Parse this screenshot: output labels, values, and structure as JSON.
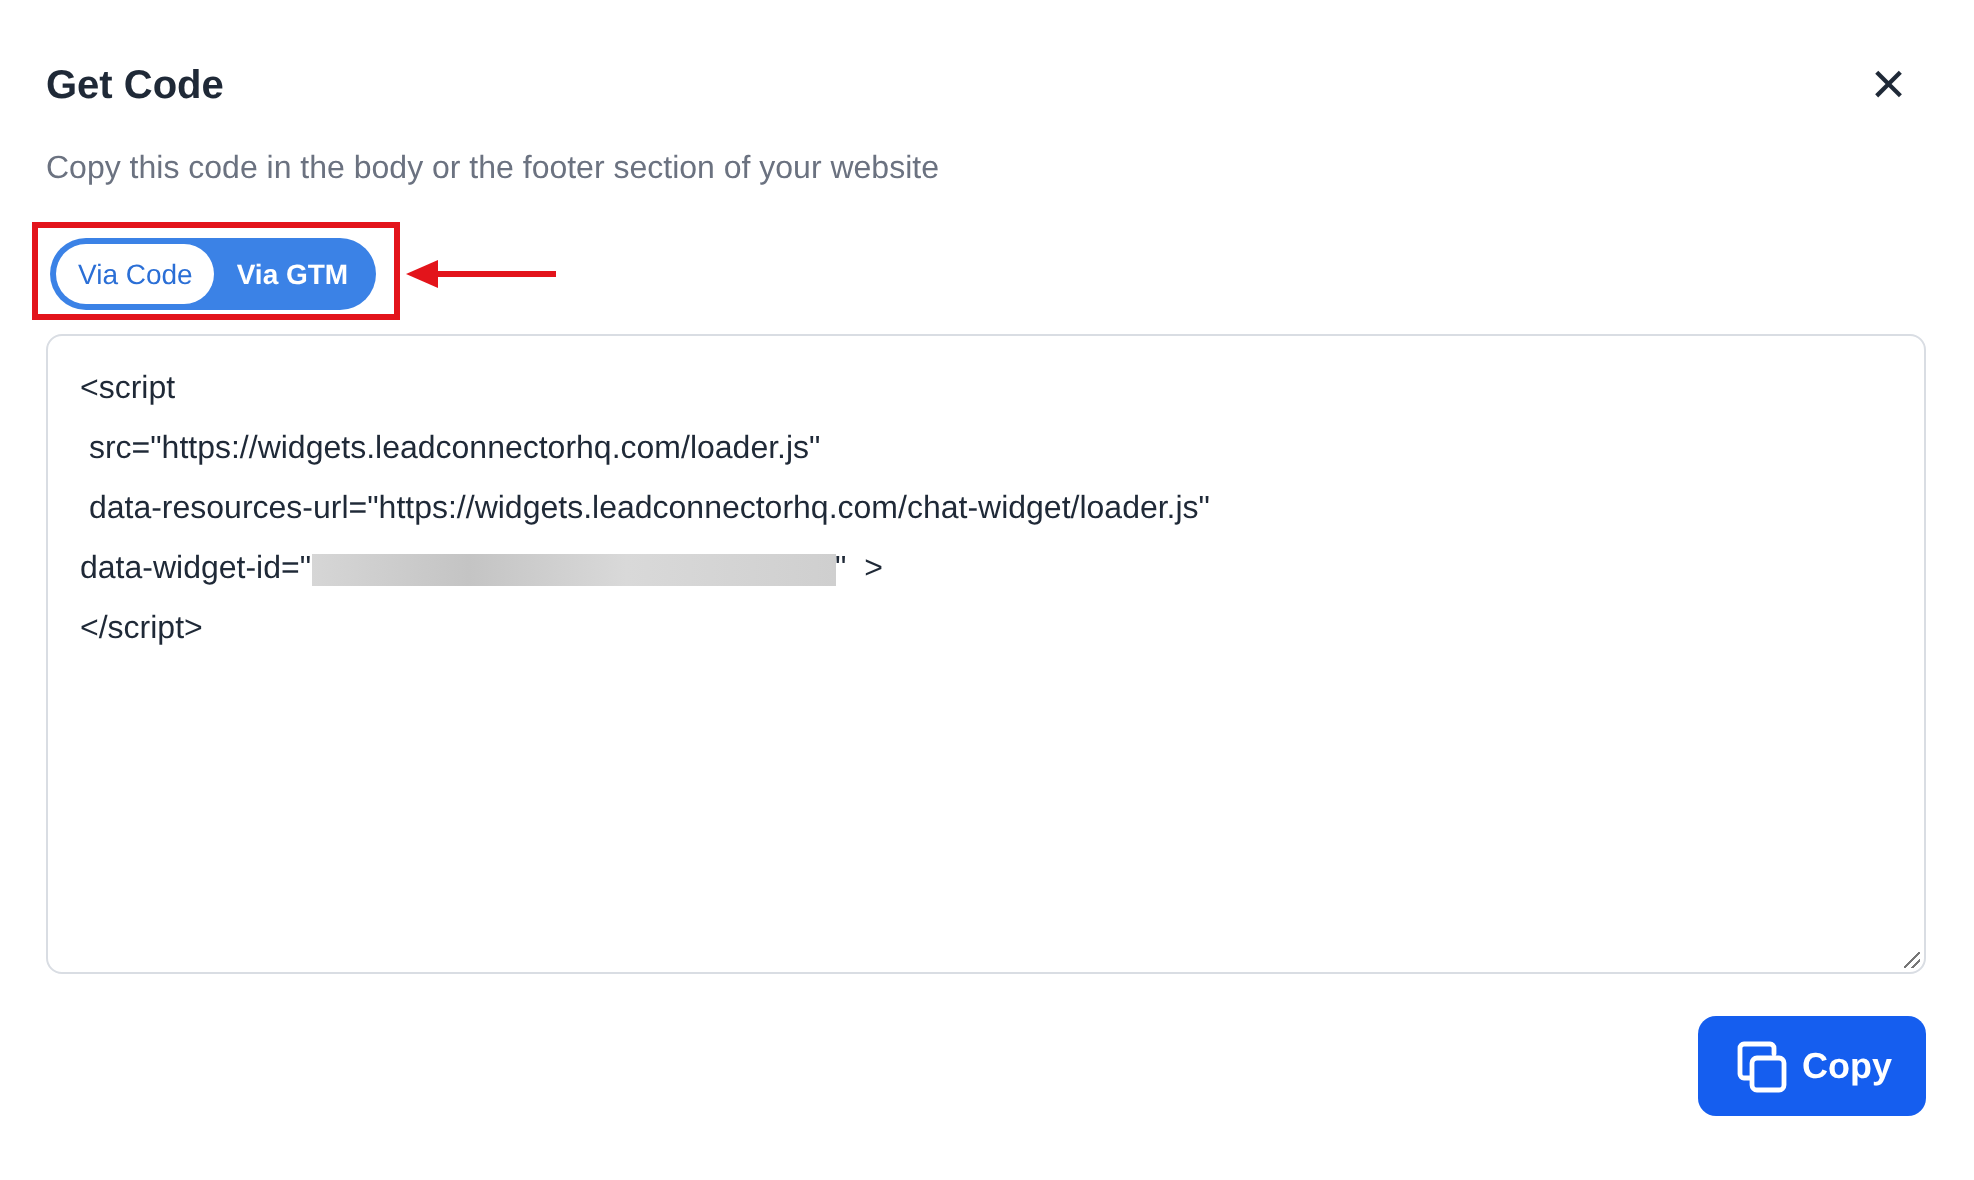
{
  "dialog": {
    "title": "Get Code",
    "close": "×",
    "subtitle": "Copy this code in the body or the footer section of your website"
  },
  "tabs": [
    {
      "label": "Via Code",
      "selected": true
    },
    {
      "label": "Via GTM",
      "selected": false
    }
  ],
  "annotation": {
    "highlight": true,
    "arrow": true
  },
  "code_lines": [
    [
      {
        "kind": "text",
        "text": "<script"
      }
    ],
    [
      {
        "kind": "text",
        "text": " src=\"https://widgets.leadconnectorhq.com/loader.js\""
      }
    ],
    [
      {
        "kind": "text",
        "text": " data-resources-url=\"https://widgets.leadconnectorhq.com/chat-widget/loader.js\""
      }
    ],
    [
      {
        "kind": "text",
        "text": "data-widget-id=\""
      },
      {
        "kind": "redacted"
      },
      {
        "kind": "text",
        "text": "\"  >"
      }
    ],
    [
      {
        "kind": "text",
        "text": "</script>"
      }
    ]
  ],
  "copy_button": {
    "label": "Copy"
  }
}
